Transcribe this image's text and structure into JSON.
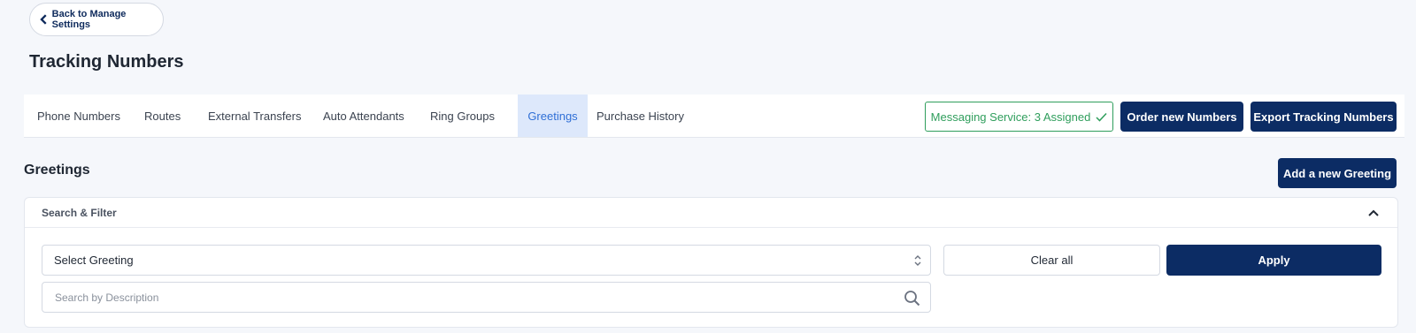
{
  "back_button": {
    "label": "Back to Manage Settings"
  },
  "page": {
    "title": "Tracking Numbers"
  },
  "tabs": [
    {
      "label": "Phone Numbers",
      "active": false
    },
    {
      "label": "Routes",
      "active": false
    },
    {
      "label": "External Transfers",
      "active": false
    },
    {
      "label": "Auto Attendants",
      "active": false
    },
    {
      "label": "Ring Groups",
      "active": false
    },
    {
      "label": "Greetings",
      "active": true
    },
    {
      "label": "Purchase History",
      "active": false
    }
  ],
  "messaging_badge": {
    "label": "Messaging Service: 3 Assigned",
    "icon": "check-icon",
    "color": "#2f9e5c"
  },
  "actions": {
    "order_label": "Order new Numbers",
    "export_label": "Export Tracking Numbers"
  },
  "section": {
    "title": "Greetings",
    "add_label": "Add a new Greeting"
  },
  "filter": {
    "title": "Search & Filter",
    "select_value": "Select Greeting",
    "search_placeholder": "Search by Description",
    "search_value": "",
    "clear_label": "Clear all",
    "apply_label": "Apply"
  },
  "colors": {
    "primary": "#0c2c64",
    "active_tab_bg": "#dde8fb",
    "active_tab_text": "#2f6fd6",
    "success": "#2f9e5c"
  }
}
